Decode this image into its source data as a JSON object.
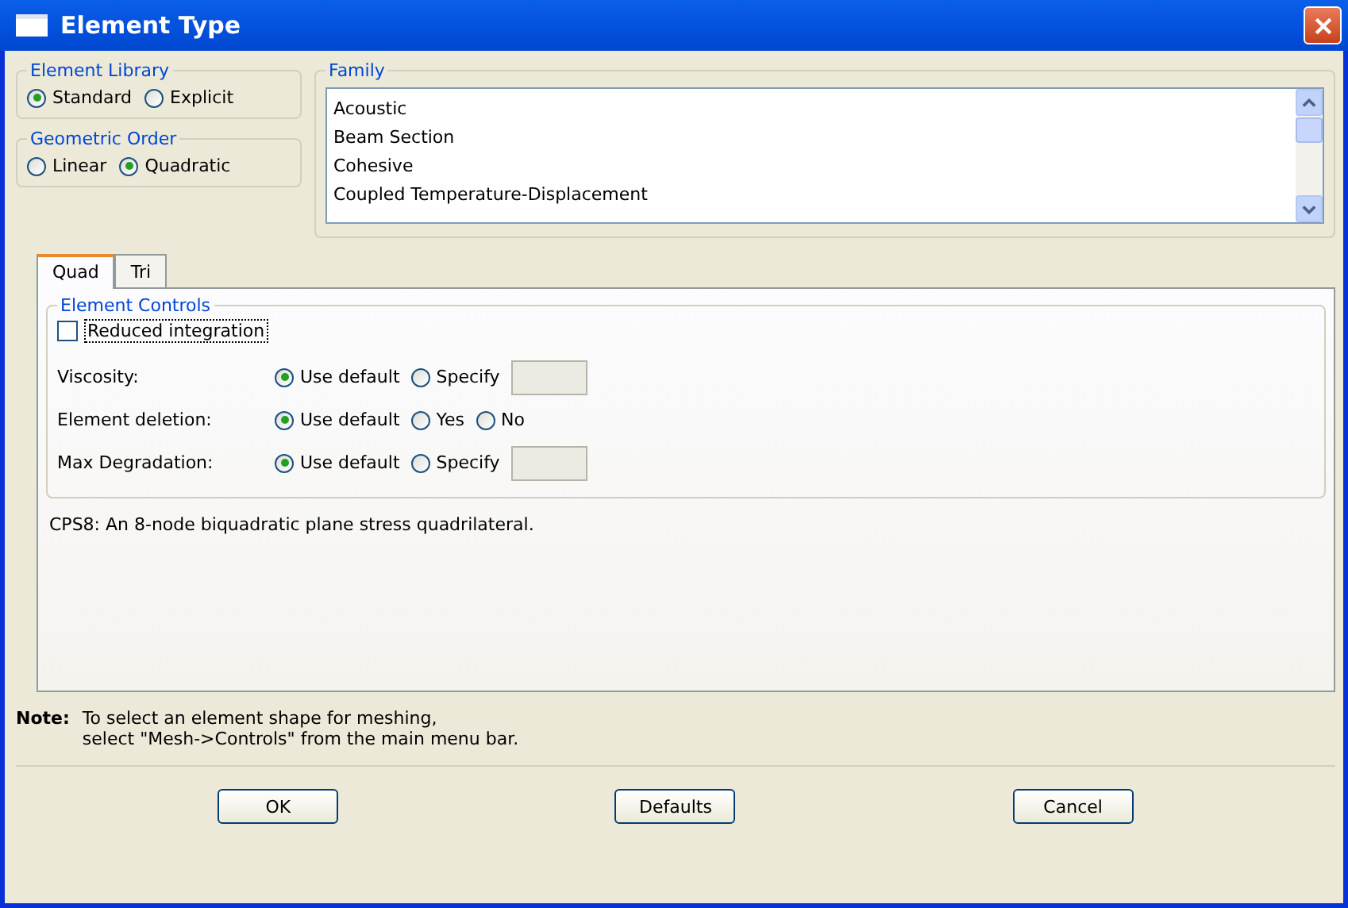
{
  "window": {
    "title": "Element Type"
  },
  "element_library": {
    "label": "Element Library",
    "options": [
      {
        "label": "Standard",
        "selected": true
      },
      {
        "label": "Explicit",
        "selected": false
      }
    ]
  },
  "geometric_order": {
    "label": "Geometric Order",
    "options": [
      {
        "label": "Linear",
        "selected": false
      },
      {
        "label": "Quadratic",
        "selected": true
      }
    ]
  },
  "family": {
    "label": "Family",
    "items": [
      "Acoustic",
      "Beam Section",
      "Cohesive",
      "Coupled Temperature-Displacement"
    ]
  },
  "tabs": [
    {
      "label": "Quad",
      "selected": true
    },
    {
      "label": "Tri",
      "selected": false
    }
  ],
  "element_controls": {
    "label": "Element Controls",
    "reduced_integration": {
      "label": "Reduced integration",
      "checked": false
    },
    "rows": [
      {
        "label": "Viscosity:",
        "options": [
          {
            "kind": "radio",
            "label": "Use default",
            "selected": true
          },
          {
            "kind": "radio",
            "label": "Specify",
            "selected": false
          },
          {
            "kind": "field",
            "disabled": true
          }
        ]
      },
      {
        "label": "Element deletion:",
        "options": [
          {
            "kind": "radio",
            "label": "Use default",
            "selected": true
          },
          {
            "kind": "radio",
            "label": "Yes",
            "selected": false
          },
          {
            "kind": "radio",
            "label": "No",
            "selected": false
          }
        ]
      },
      {
        "label": "Max Degradation:",
        "options": [
          {
            "kind": "radio",
            "label": "Use default",
            "selected": true
          },
          {
            "kind": "radio",
            "label": "Specify",
            "selected": false
          },
          {
            "kind": "field",
            "disabled": true
          }
        ]
      }
    ]
  },
  "description": "CPS8:  An 8-node biquadratic plane stress quadrilateral.",
  "note": {
    "label": "Note:",
    "lines": [
      "To select an element shape for meshing,",
      "select \"Mesh->Controls\" from the main menu bar."
    ]
  },
  "buttons": [
    "OK",
    "Defaults",
    "Cancel"
  ]
}
